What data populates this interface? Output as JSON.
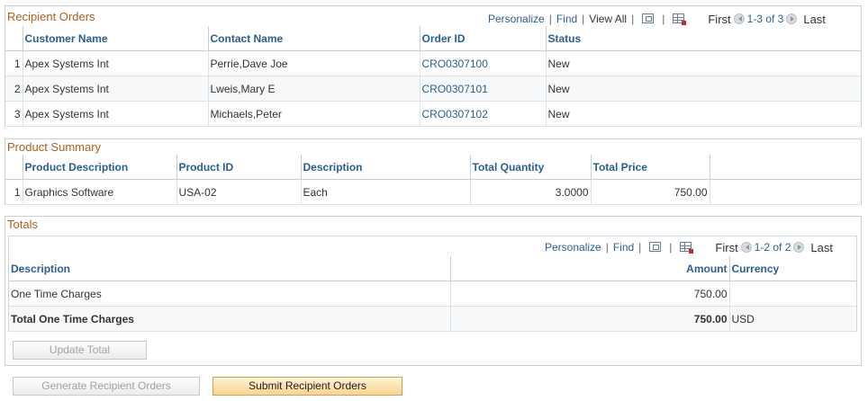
{
  "recipient_orders": {
    "title": "Recipient Orders",
    "nav": {
      "personalize": "Personalize",
      "find": "Find",
      "view_all": "View All",
      "first": "First",
      "range": "1-3 of 3",
      "last": "Last"
    },
    "columns": [
      "Customer Name",
      "Contact Name",
      "Order ID",
      "Status"
    ],
    "rows": [
      {
        "idx": "1",
        "customer": "Apex Systems Int",
        "contact": "Perrie,Dave Joe",
        "order_id": "CRO0307100",
        "status": "New"
      },
      {
        "idx": "2",
        "customer": "Apex Systems Int",
        "contact": "Lweis,Mary E",
        "order_id": "CRO0307101",
        "status": "New"
      },
      {
        "idx": "3",
        "customer": "Apex Systems Int",
        "contact": "Michaels,Peter",
        "order_id": "CRO0307102",
        "status": "New"
      }
    ]
  },
  "product_summary": {
    "title": "Product Summary",
    "columns": [
      "Product Description",
      "Product ID",
      "Description",
      "Total Quantity",
      "Total Price"
    ],
    "rows": [
      {
        "idx": "1",
        "product_desc": "Graphics Software",
        "product_id": "USA-02",
        "description": "Each",
        "total_qty": "3.0000",
        "total_price": "750.00"
      }
    ]
  },
  "totals": {
    "title": "Totals",
    "nav": {
      "personalize": "Personalize",
      "find": "Find",
      "first": "First",
      "range": "1-2 of 2",
      "last": "Last"
    },
    "columns": [
      "Description",
      "Amount",
      "Currency"
    ],
    "rows": [
      {
        "description": "One Time Charges",
        "amount": "750.00",
        "currency": ""
      },
      {
        "description": "Total One Time Charges",
        "amount": "750.00",
        "currency": "USD"
      }
    ],
    "update_button": "Update Total"
  },
  "actions": {
    "generate": "Generate Recipient Orders",
    "submit": "Submit Recipient Orders"
  },
  "icons": [
    "zoom-icon",
    "download-grid-icon",
    "prev-arrow-icon",
    "next-arrow-icon"
  ]
}
